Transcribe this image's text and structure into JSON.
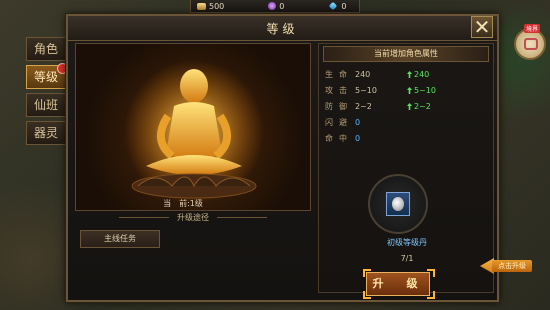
{
  "resources": [
    {
      "icon": "ingot-icon",
      "value": "500"
    },
    {
      "icon": "orb-icon",
      "value": "0"
    },
    {
      "icon": "diamond-icon",
      "value": "0"
    }
  ],
  "window": {
    "title": "等级",
    "close_label": "✕"
  },
  "tabs": [
    {
      "label": "角色",
      "active": false,
      "notify": false
    },
    {
      "label": "等级",
      "active": true,
      "notify": true
    },
    {
      "label": "仙班",
      "active": false,
      "notify": false
    },
    {
      "label": "器灵",
      "active": false,
      "notify": false
    }
  ],
  "left": {
    "current_level_label": "当　前:1级",
    "route_label": "升级途径",
    "mission_button": "主线任务"
  },
  "stats_panel": {
    "title": "当前增加角色属性",
    "rows": [
      {
        "key": "生命",
        "value": "240",
        "gain": "240"
      },
      {
        "key": "攻击",
        "value": "5~10",
        "gain": "5~10"
      },
      {
        "key": "防御",
        "value": "2~2",
        "gain": "2~2"
      },
      {
        "key": "闪避",
        "value": "0",
        "gain": ""
      },
      {
        "key": "命中",
        "value": "0",
        "gain": ""
      }
    ]
  },
  "item": {
    "name": "初级等级丹",
    "count": "7/1"
  },
  "upgrade_button": "升　级",
  "hint_tag": "点击升级",
  "side_badge": "境界",
  "colors": {
    "gain": "#58e65c",
    "accent": "#ffb23a",
    "item_name": "#7ec8ff"
  }
}
